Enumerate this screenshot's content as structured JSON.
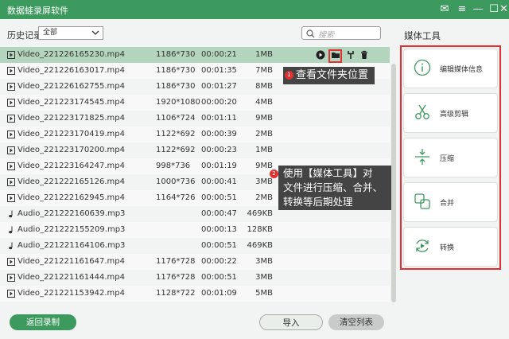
{
  "app": {
    "title": "数据蛙录屏软件"
  },
  "toolbar": {
    "history_label": "历史记录",
    "filter_value": "全部",
    "search_placeholder": "搜索"
  },
  "files": [
    {
      "type": "video",
      "name": "Video_221226165230.mp4",
      "res": "1186*730",
      "dur": "00:00:21",
      "size": "1MB"
    },
    {
      "type": "video",
      "name": "Video_221226163017.mp4",
      "res": "1186*730",
      "dur": "00:01:35",
      "size": "7MB"
    },
    {
      "type": "video",
      "name": "Video_221226162755.mp4",
      "res": "1186*730",
      "dur": "00:01:27",
      "size": "8MB"
    },
    {
      "type": "video",
      "name": "Video_221223174545.mp4",
      "res": "1920*1080",
      "dur": "00:00:20",
      "size": "4MB"
    },
    {
      "type": "video",
      "name": "Video_221223171825.mp4",
      "res": "1106*724",
      "dur": "00:01:11",
      "size": "9MB"
    },
    {
      "type": "video",
      "name": "Video_221223170419.mp4",
      "res": "1122*692",
      "dur": "00:00:39",
      "size": "2MB"
    },
    {
      "type": "video",
      "name": "Video_221223170200.mp4",
      "res": "1122*692",
      "dur": "00:00:23",
      "size": "1MB"
    },
    {
      "type": "video",
      "name": "Video_221223164247.mp4",
      "res": "998*736",
      "dur": "00:01:19",
      "size": "9MB"
    },
    {
      "type": "video",
      "name": "Video_221222165126.mp4",
      "res": "1000*736",
      "dur": "00:00:41",
      "size": "3MB"
    },
    {
      "type": "video",
      "name": "Video_221222162945.mp4",
      "res": "1164*726",
      "dur": "00:00:51",
      "size": "2MB"
    },
    {
      "type": "audio",
      "name": "Audio_221222160639.mp3",
      "res": "",
      "dur": "00:00:47",
      "size": "469KB"
    },
    {
      "type": "audio",
      "name": "Audio_221222155209.mp3",
      "res": "",
      "dur": "00:00:13",
      "size": "128KB"
    },
    {
      "type": "audio",
      "name": "Audio_221221164106.mp3",
      "res": "",
      "dur": "00:00:51",
      "size": "469KB"
    },
    {
      "type": "video",
      "name": "Video_221221161647.mp4",
      "res": "1176*728",
      "dur": "00:00:22",
      "size": "3MB"
    },
    {
      "type": "video",
      "name": "Video_221221161444.mp4",
      "res": "1176*728",
      "dur": "00:00:51",
      "size": "3MB"
    },
    {
      "type": "video",
      "name": "Video_221221153942.mp4",
      "res": "1128*722",
      "dur": "00:01:09",
      "size": "5MB"
    }
  ],
  "row_actions": [
    "play-icon",
    "folder-icon",
    "tools-icon",
    "trash-icon"
  ],
  "annotations": {
    "tip1": {
      "badge": "1",
      "text": "查看文件夹位置"
    },
    "tip2": {
      "badge": "2",
      "lines": [
        "使用【媒体工具】对",
        "文件进行压缩、合并、",
        "转换等后期处理"
      ]
    }
  },
  "sidebar": {
    "title": "媒体工具",
    "tools": [
      {
        "label": "编辑媒体信息",
        "icon": "info-icon"
      },
      {
        "label": "高级剪辑",
        "icon": "scissors-icon"
      },
      {
        "label": "压缩",
        "icon": "compress-icon"
      },
      {
        "label": "合并",
        "icon": "merge-icon"
      },
      {
        "label": "转换",
        "icon": "convert-icon"
      }
    ]
  },
  "footer": {
    "back_label": "返回录制",
    "import_label": "导入",
    "clear_label": "清空列表"
  },
  "colors": {
    "brand": "#3d9a5e",
    "selected_row": "#b3d4bd",
    "highlight": "#e03030",
    "tooltip": "#444444"
  }
}
